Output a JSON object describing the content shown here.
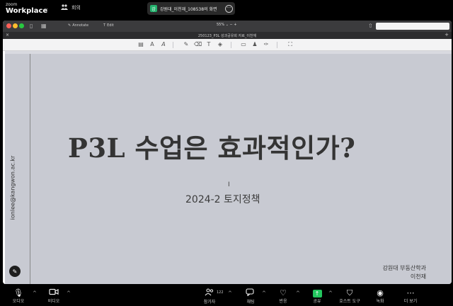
{
  "zoom_top": {
    "brand_small": "zoom",
    "brand_big": "Workplace",
    "meeting_label": "회의",
    "share_badge": "강",
    "share_title": "강원대_이천재_108538의 화면",
    "more_label": "···"
  },
  "viewer": {
    "tools_annotate": "Annotate",
    "tools_edit": "Edit",
    "zoom_level": "55%",
    "document_title": "250123_P3L 성과공유회 자료_이천재"
  },
  "slide": {
    "title": "P3L 수업은 효과적인가?",
    "subtitle": "2024-2 토지정책",
    "affiliation": "강원대 부동산학과",
    "presenter": "이천재",
    "email": "ionlee@kangwon.ac.kr"
  },
  "zoom_bottom": {
    "audio": "오디오",
    "video": "비디오",
    "participants": "참가자",
    "participants_count": "122",
    "chat": "채팅",
    "reactions": "반응",
    "share": "공유",
    "host_tools": "호스트 도구",
    "record": "녹화",
    "more": "더 보기"
  },
  "colors": {
    "share_green": "#23c55e",
    "slide_bg": "#c8cad2",
    "title_color": "#343434"
  }
}
